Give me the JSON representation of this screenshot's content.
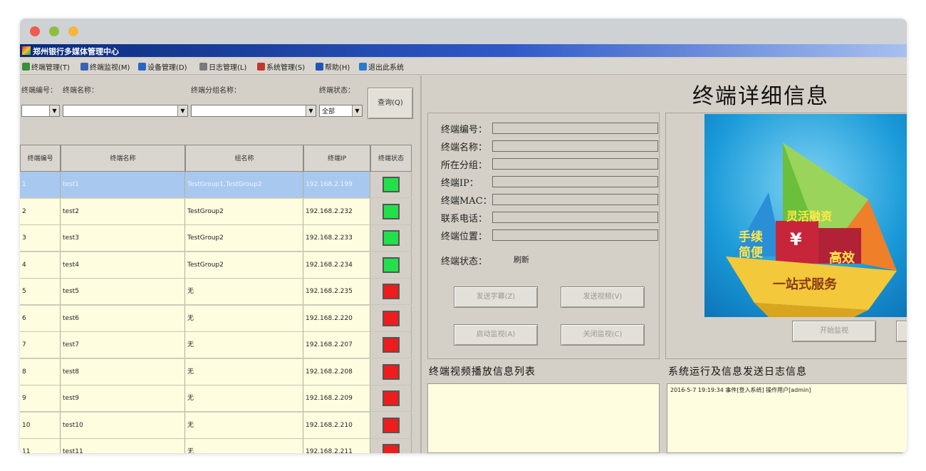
{
  "window": {
    "title": "郑州银行多媒体管理中心"
  },
  "menu": [
    {
      "label": "终端管理(T)",
      "icon": "people-icon",
      "color": "#3a8f3a"
    },
    {
      "label": "终端监视(M)",
      "icon": "monitor-icon",
      "color": "#3a62b5"
    },
    {
      "label": "设备管理(D)",
      "icon": "shield-icon",
      "color": "#2a63c8"
    },
    {
      "label": "日志管理(L)",
      "icon": "document-icon",
      "color": "#7a7a7a"
    },
    {
      "label": "系统管理(S)",
      "icon": "tools-icon",
      "color": "#c0392b"
    },
    {
      "label": "帮助(H)",
      "icon": "help-icon",
      "color": "#1f56b8"
    },
    {
      "label": "退出此系统",
      "icon": "exit-icon",
      "color": "#2a7ad0"
    }
  ],
  "filters": {
    "terminal_id_label": "终端编号：",
    "terminal_name_label": "终端名称：",
    "group_label": "终端分组名称：",
    "status_label": "终端状态：",
    "status_value": "全部",
    "query_button": "查询(Q)"
  },
  "table": {
    "columns": [
      "终端编号",
      "终端名称",
      "组名称",
      "终端IP",
      "终端状态"
    ],
    "rows": [
      {
        "id": "1",
        "name": "test1",
        "group": "TestGroup1,TestGroup2",
        "ip": "192.168.2.199",
        "status": "online",
        "selected": true
      },
      {
        "id": "2",
        "name": "test2",
        "group": "TestGroup2",
        "ip": "192.168.2.232",
        "status": "online"
      },
      {
        "id": "3",
        "name": "test3",
        "group": "TestGroup2",
        "ip": "192.168.2.233",
        "status": "online"
      },
      {
        "id": "4",
        "name": "test4",
        "group": "TestGroup2",
        "ip": "192.168.2.234",
        "status": "online"
      },
      {
        "id": "5",
        "name": "test5",
        "group": "无",
        "ip": "192.168.2.235",
        "status": "offline"
      },
      {
        "id": "6",
        "name": "test6",
        "group": "无",
        "ip": "192.168.2.220",
        "status": "offline"
      },
      {
        "id": "7",
        "name": "test7",
        "group": "无",
        "ip": "192.168.2.207",
        "status": "offline"
      },
      {
        "id": "8",
        "name": "test8",
        "group": "无",
        "ip": "192.168.2.208",
        "status": "offline"
      },
      {
        "id": "9",
        "name": "test9",
        "group": "无",
        "ip": "192.168.2.209",
        "status": "offline"
      },
      {
        "id": "10",
        "name": "test10",
        "group": "无",
        "ip": "192.168.2.210",
        "status": "offline"
      },
      {
        "id": "11",
        "name": "test11",
        "group": "无",
        "ip": "192.168.2.211",
        "status": "offline"
      }
    ]
  },
  "colors": {
    "online": "#22e04a",
    "offline": "#ee1c1c",
    "row_bg": "#fffde0",
    "row_selected": "#a9c8ef"
  },
  "details": {
    "title": "终端详细信息",
    "fields": [
      "终端编号：",
      "终端名称：",
      "所在分组：",
      "终端IP：",
      "终端MAC：",
      "联系电话：",
      "终端位置："
    ],
    "status_label": "终端状态：",
    "status_value": "刷新",
    "buttons": {
      "send_subtitle": "发送字幕(Z)",
      "send_video": "发送视频(V)",
      "start_monitor": "启动监视(A)",
      "stop_monitor": "关闭监视(C)",
      "open_monitor": "开始监视"
    }
  },
  "graphic": {
    "t1": "灵活融资",
    "t2": "手续",
    "t3": "简便",
    "t4": "¥",
    "t5": "高效",
    "t6": "一站式服务"
  },
  "video_list": {
    "title": "终端视频播放信息列表"
  },
  "log": {
    "title": "系统运行及信息发送日志信息",
    "entries": [
      "2016-5-7 19:19:34    事件[登入系统]  操作用户[admin]"
    ]
  }
}
